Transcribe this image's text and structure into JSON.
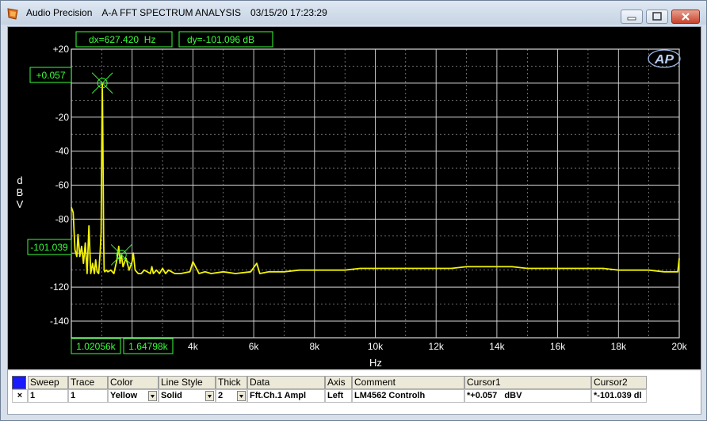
{
  "window": {
    "app_name": "Audio Precision",
    "title": "A-A FFT SPECTRUM ANALYSIS",
    "timestamp": "03/15/20 17:23:29",
    "buttons": {
      "minimize": "minimize",
      "maximize": "maximize",
      "close": "close"
    }
  },
  "plot": {
    "dx_readout": "dx=627.420  Hz",
    "dy_readout": "dy=-101.096 dB",
    "logo": "AP",
    "cursor1_value": "+0.057",
    "cursor2_value": "-101.039",
    "cursor1_freq": "1.02056k",
    "cursor2_freq": "1.64798k",
    "colors": {
      "trace": "#f2f20a",
      "grid": "#d9d9d9",
      "readout": "#39ff39",
      "background": "#000000"
    }
  },
  "chart_data": {
    "type": "line",
    "xlabel": "Hz",
    "ylabel": "dBV",
    "xlim": [
      0,
      20000
    ],
    "ylim": [
      -150,
      20
    ],
    "grid": true,
    "x_ticks": [
      "4k",
      "6k",
      "8k",
      "10k",
      "12k",
      "14k",
      "16k",
      "18k",
      "20k"
    ],
    "y_ticks": [
      "+20",
      "-20",
      "-40",
      "-60",
      "-80",
      "-120",
      "-140"
    ],
    "series": [
      {
        "color": "#f2f20a",
        "x": [
          0,
          60,
          120,
          180,
          220,
          280,
          340,
          400,
          460,
          520,
          580,
          640,
          700,
          760,
          800,
          850,
          900,
          950,
          980,
          1000,
          1020,
          1040,
          1060,
          1080,
          1100,
          1150,
          1200,
          1300,
          1400,
          1500,
          1560,
          1600,
          1648,
          1700,
          1800,
          1900,
          2000,
          2040,
          2100,
          2200,
          2300,
          2400,
          2600,
          2650,
          2700,
          2800,
          2900,
          3000,
          3100,
          3200,
          3400,
          3600,
          3900,
          4000,
          4200,
          4400,
          4600,
          5000,
          5400,
          5900,
          6100,
          6200,
          6500,
          7000,
          7500,
          8000,
          8500,
          9000,
          9500,
          10000,
          10500,
          11000,
          11500,
          12000,
          12500,
          13000,
          13500,
          14000,
          14500,
          15000,
          15500,
          16000,
          16500,
          17000,
          17500,
          18000,
          18500,
          19000,
          19500,
          19950,
          20000
        ],
        "y": [
          -73,
          -76,
          -98,
          -102,
          -89,
          -102,
          -96,
          -106,
          -94,
          -112,
          -84,
          -112,
          -106,
          -112,
          -104,
          -111,
          -112,
          -99,
          -88,
          -40,
          0.057,
          -40,
          -90,
          -110,
          -111,
          -110,
          -111,
          -110,
          -112,
          -104,
          -96,
          -106,
          -101.039,
          -108,
          -103,
          -110,
          -105,
          -100,
          -110,
          -112,
          -112,
          -110,
          -112,
          -108,
          -112,
          -110,
          -112,
          -109,
          -112,
          -110,
          -112,
          -112,
          -111,
          -105,
          -112,
          -111,
          -112,
          -111,
          -112,
          -111,
          -106,
          -112,
          -111,
          -111,
          -110,
          -110,
          -110,
          -110,
          -109,
          -109,
          -109,
          -109,
          -109,
          -109,
          -109,
          -108,
          -108,
          -108,
          -108,
          -109,
          -109,
          -109,
          -109,
          -109,
          -109,
          -110,
          -110,
          -110,
          -111,
          -111,
          -103
        ]
      }
    ],
    "cursors": [
      {
        "x": 1020.56,
        "y": 0.057
      },
      {
        "x": 1647.98,
        "y": -101.039
      }
    ]
  },
  "grid_table": {
    "headers": [
      "Sweep",
      "Trace",
      "Color",
      "Line Style",
      "Thick",
      "Data",
      "Axis",
      "Comment",
      "Cursor1",
      "Cursor2"
    ],
    "row": {
      "check": "×",
      "sweep": "1",
      "trace": "1",
      "color": "Yellow",
      "line_style": "Solid",
      "thick": "2",
      "data": "Fft.Ch.1 Ampl",
      "axis": "Left",
      "comment": "LM4562 Controlh",
      "cursor1": "*+0.057   dBV",
      "cursor2": "*-101.039 dl"
    },
    "swatch_color": "#1a1aff"
  }
}
